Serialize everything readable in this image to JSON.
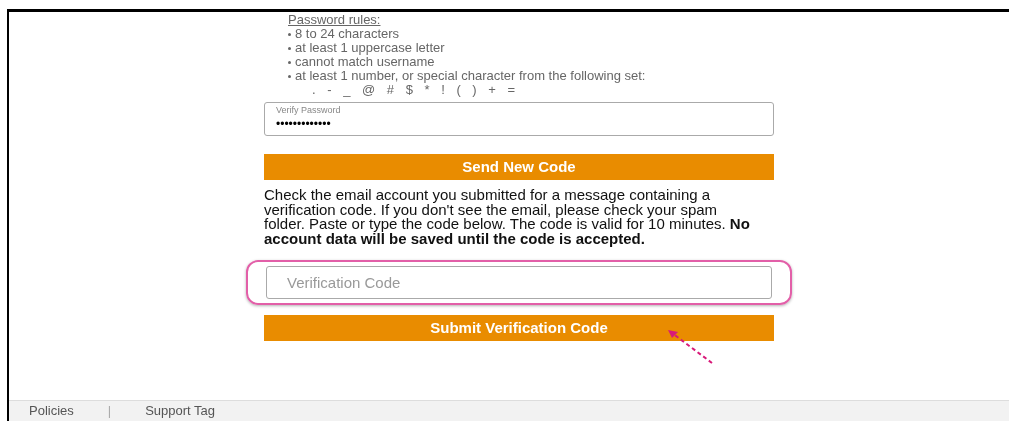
{
  "password_rules": {
    "title": "Password rules:",
    "items": [
      "8 to 24 characters",
      "at least 1 uppercase letter",
      "cannot match username",
      "at least 1 number, or special character from the following set:"
    ],
    "special_set": ". - _ @ # $ * ! ( ) + ="
  },
  "verify_password": {
    "label": "Verify Password",
    "value": "•••••••••••••"
  },
  "send_button": "Send New Code",
  "instructions": "Check the email account you submitted for a message containing a verification code. If you don't see the email, please check your spam folder. Paste or type the code below. The code is valid for 10 minutes. **No account data will be saved until the code is accepted.**",
  "verification_code": {
    "placeholder": "Verification Code",
    "highlighted": true
  },
  "submit_button": "Submit Verification Code",
  "footer": {
    "links": [
      "Policies",
      "Support Tag"
    ],
    "separator": "|"
  }
}
